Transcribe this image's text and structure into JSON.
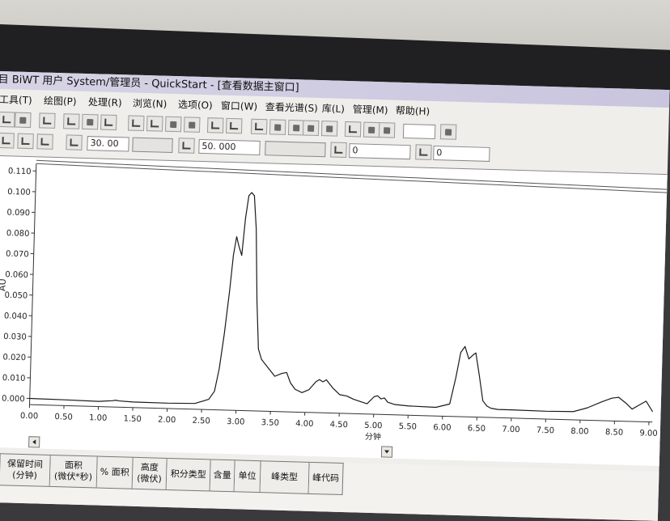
{
  "window": {
    "title": "目 BiWT 用户 System/管理员 - QuickStart - [查看数据主窗口]"
  },
  "menu": [
    {
      "label": "工具(T)"
    },
    {
      "label": "绘图(P)"
    },
    {
      "label": "处理(R)"
    },
    {
      "label": "浏览(N)"
    },
    {
      "label": "选项(O)"
    },
    {
      "label": "窗口(W)"
    },
    {
      "label": "查看光谱(S)"
    },
    {
      "label": "库(L)"
    },
    {
      "label": "管理(M)"
    },
    {
      "label": "帮助(H)"
    }
  ],
  "toolbar": {
    "value1": "30. 00",
    "value2": "50. 000",
    "value3": "0",
    "value4": "0"
  },
  "chart_data": {
    "type": "line",
    "ylabel": "AU",
    "xlabel": "分钟",
    "xlim": [
      0.0,
      9.05
    ],
    "ylim": [
      -0.003,
      0.112
    ],
    "xticks": [
      "0.00",
      "0.50",
      "1.00",
      "1.50",
      "2.00",
      "2.50",
      "3.00",
      "3.50",
      "4.00",
      "4.50",
      "5.00",
      "5.50",
      "6.00",
      "6.50",
      "7.00",
      "7.50",
      "8.00",
      "8.50",
      "9.00"
    ],
    "yticks": [
      "0.000",
      "0.010",
      "0.020",
      "0.030",
      "0.040",
      "0.050",
      "0.060",
      "0.070",
      "0.080",
      "0.090",
      "0.100",
      "0.110"
    ],
    "grid": false,
    "series": [
      {
        "x": [
          0.0,
          0.5,
          1.0,
          1.2,
          1.25,
          1.3,
          1.5,
          2.0,
          2.4,
          2.6,
          2.68,
          2.74,
          2.8,
          2.86,
          2.9,
          2.94,
          2.98,
          3.02,
          3.06,
          3.1,
          3.14,
          3.18,
          3.22,
          3.26,
          3.3,
          3.35,
          3.45,
          3.55,
          3.65,
          3.72,
          3.78,
          3.85,
          3.95,
          4.05,
          4.15,
          4.2,
          4.25,
          4.3,
          4.35,
          4.4,
          4.5,
          4.6,
          4.7,
          4.8,
          4.9,
          5.0,
          5.05,
          5.1,
          5.15,
          5.2,
          5.3,
          5.5,
          5.9,
          6.1,
          6.18,
          6.24,
          6.3,
          6.36,
          6.42,
          6.46,
          6.52,
          6.58,
          6.64,
          6.7,
          6.8,
          7.0,
          7.5,
          7.9,
          8.1,
          8.3,
          8.45,
          8.55,
          8.65,
          8.75,
          8.85,
          8.95,
          9.05
        ],
        "y": [
          0.0,
          -0.0002,
          -0.0005,
          0.0,
          0.0003,
          0.0,
          -0.0003,
          -0.0004,
          -0.0002,
          0.002,
          0.006,
          0.017,
          0.034,
          0.055,
          0.072,
          0.081,
          0.076,
          0.072,
          0.09,
          0.101,
          0.1025,
          0.101,
          0.085,
          0.05,
          0.027,
          0.022,
          0.018,
          0.014,
          0.0155,
          0.016,
          0.011,
          0.008,
          0.0065,
          0.008,
          0.012,
          0.013,
          0.012,
          0.013,
          0.011,
          0.009,
          0.006,
          0.0055,
          0.004,
          0.003,
          0.002,
          0.0055,
          0.006,
          0.0045,
          0.005,
          0.003,
          0.002,
          0.0015,
          0.0012,
          0.003,
          0.016,
          0.028,
          0.031,
          0.025,
          0.027,
          0.028,
          0.017,
          0.005,
          0.0025,
          0.0015,
          0.001,
          0.001,
          0.0008,
          0.001,
          0.003,
          0.006,
          0.008,
          0.0085,
          0.006,
          0.003,
          0.005,
          0.007,
          0.002
        ]
      }
    ]
  }
}
